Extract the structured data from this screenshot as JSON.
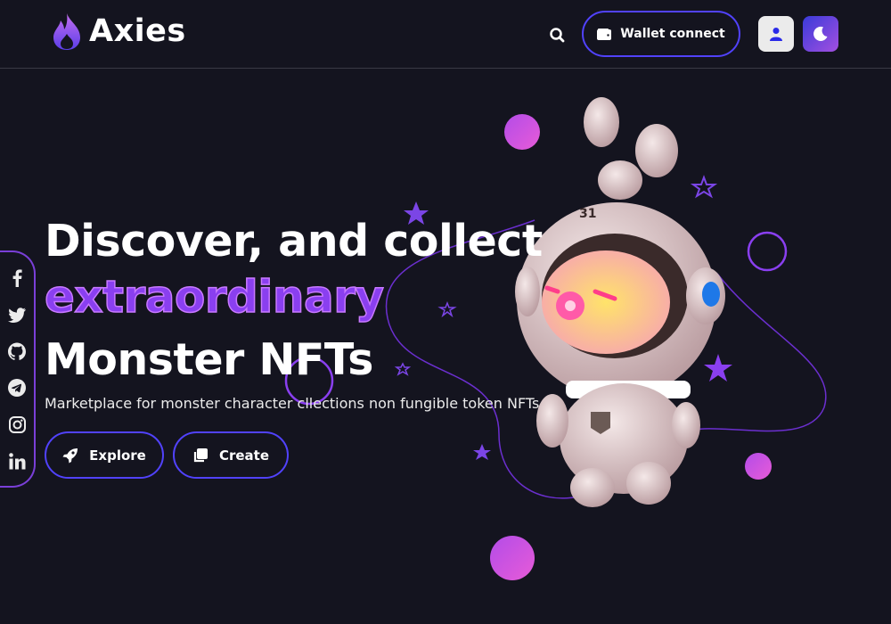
{
  "header": {
    "brand": "Axies",
    "wallet_label": "Wallet connect"
  },
  "hero": {
    "line1": "Discover, and collect",
    "highlight": "extraordinary",
    "line3": "Monster NFTs",
    "subtitle": "Marketplace for monster character cllections non fungible token NFTs",
    "explore_label": "Explore",
    "create_label": "Create"
  },
  "social": [
    "facebook-icon",
    "twitter-icon",
    "github-icon",
    "telegram-icon",
    "instagram-icon",
    "linkedin-icon"
  ],
  "colors": {
    "background": "#14141f",
    "accent": "#5142fc",
    "highlight": "#8a3ff0",
    "gradient_start": "#a34fe0",
    "gradient_end": "#3a3bd9"
  }
}
